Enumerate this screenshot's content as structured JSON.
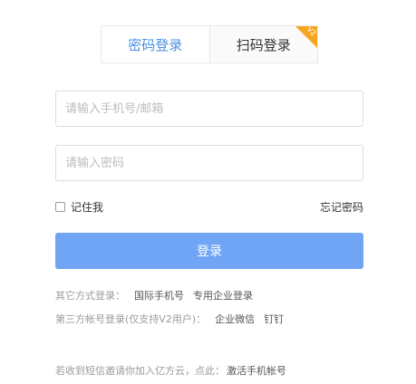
{
  "tabs": {
    "password_login": "密码登录",
    "qrcode_login": "扫码登录",
    "qrcode_badge": "V2"
  },
  "form": {
    "account_placeholder": "请输入手机号/邮箱",
    "password_placeholder": "请输入密码",
    "remember_label": "记住我",
    "forgot_label": "忘记密码",
    "login_label": "登录"
  },
  "other": {
    "label": "其它方式登录：",
    "intl_phone": "国际手机号",
    "enterprise": "专用企业登录"
  },
  "third_party": {
    "label": "第三方帐号登录(仅支持V2用户)：",
    "wechat_work": "企业微信",
    "dingtalk": "钉钉"
  },
  "invite": {
    "label": "若收到短信邀请你加入亿方云，点此：",
    "activate": "激活手机帐号"
  },
  "colors": {
    "accent": "#4a90e2",
    "button": "#70a4f5",
    "badge": "#f5a623"
  }
}
